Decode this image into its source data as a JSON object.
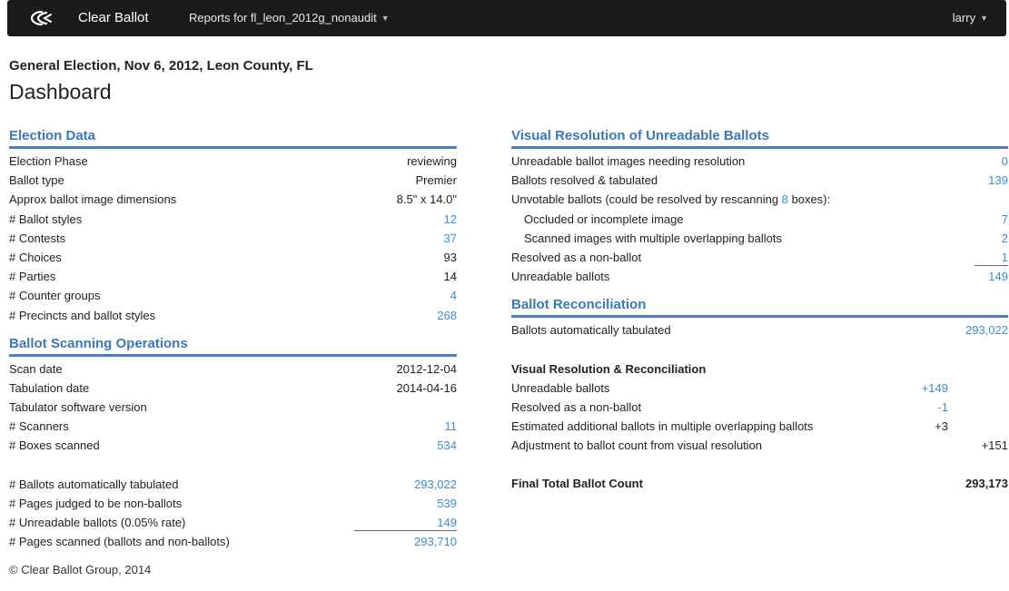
{
  "navbar": {
    "brand": "Clear Ballot",
    "reports": "Reports for fl_leon_2012g_nonaudit",
    "user": "larry",
    "caret": "▼"
  },
  "header": {
    "subtitle": "General Election, Nov 6, 2012, Leon County, FL",
    "title": "Dashboard"
  },
  "election_data": {
    "heading": "Election Data",
    "rows": [
      {
        "label": "Election Phase",
        "value": "reviewing"
      },
      {
        "label": "Ballot type",
        "value": "Premier"
      },
      {
        "label": "Approx ballot image dimensions",
        "value": "8.5\" x 14.0\""
      },
      {
        "label": "# Ballot styles",
        "value": "12"
      },
      {
        "label": "# Contests",
        "value": "37"
      },
      {
        "label": "# Choices",
        "value": "93"
      },
      {
        "label": "# Parties",
        "value": "14"
      },
      {
        "label": "# Counter groups",
        "value": "4"
      },
      {
        "label": "# Precincts and ballot styles",
        "value": "268"
      }
    ]
  },
  "scanning": {
    "heading": "Ballot Scanning Operations",
    "rows": [
      {
        "label": "Scan date",
        "value": "2012-12-04"
      },
      {
        "label": "Tabulation date",
        "value": "2014-04-16"
      },
      {
        "label": "Tabulator software version",
        "value": ""
      },
      {
        "label": "# Scanners",
        "value": "11"
      },
      {
        "label": "# Boxes scanned",
        "value": "534"
      }
    ],
    "totals": [
      {
        "label": "# Ballots automatically tabulated",
        "value": "293,022"
      },
      {
        "label": "# Pages judged to be non-ballots",
        "value": "539"
      },
      {
        "label": "# Unreadable ballots (0.05% rate)",
        "value": "149"
      },
      {
        "label": "# Pages scanned (ballots and non-ballots)",
        "value": "293,710"
      }
    ]
  },
  "visual_resolution": {
    "heading": "Visual Resolution of Unreadable Ballots",
    "rows": [
      {
        "label": "Unreadable ballot images needing resolution",
        "value": "0"
      },
      {
        "label": "Ballots resolved & tabulated",
        "value": "139"
      }
    ],
    "unvotable_prefix": "Unvotable ballots (could be resolved by rescanning ",
    "unvotable_boxes": "8",
    "unvotable_suffix": " boxes):",
    "sub_rows": [
      {
        "label": "Occluded or incomplete image",
        "value": "7"
      },
      {
        "label": "Scanned images with multiple overlapping ballots",
        "value": "2"
      }
    ],
    "nonballot": {
      "label": "Resolved as a non-ballot",
      "value": "1"
    },
    "unreadable": {
      "label": "Unreadable ballots",
      "value": "149"
    }
  },
  "reconciliation": {
    "heading": "Ballot Reconciliation",
    "auto": {
      "label": "Ballots automatically tabulated",
      "value": "293,022"
    },
    "sub_heading": "Visual Resolution & Reconciliation",
    "rows": [
      {
        "label": "Unreadable ballots",
        "mid": "+149"
      },
      {
        "label": "Resolved as a non-ballot",
        "mid": "-1"
      },
      {
        "label": "Estimated additional ballots in multiple overlapping ballots",
        "mid": "+3"
      }
    ],
    "adjustment": {
      "label": "Adjustment to ballot count from visual resolution",
      "value": "+151"
    },
    "final": {
      "label": "Final Total Ballot Count",
      "value": "293,173"
    }
  },
  "footer": "© Clear Ballot Group, 2014",
  "colors": {
    "accent": "#3a78bb",
    "link": "#3a8ed0",
    "navbar": "#1b1b1b"
  },
  "icons": {
    "logo": "clear-ballot-logo",
    "caret": "chevron-down-icon"
  }
}
